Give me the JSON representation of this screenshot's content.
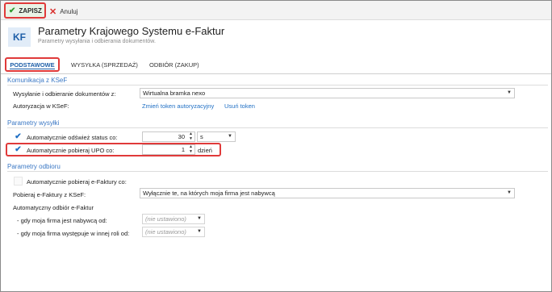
{
  "toolbar": {
    "save_label": "ZAPISZ",
    "cancel_label": "Anuluj"
  },
  "header": {
    "logo": "KF",
    "title": "Parametry Krajowego Systemu e-Faktur",
    "subtitle": "Parametry wysyłania i odbierania dokumentów."
  },
  "tabs": [
    {
      "label": "PODSTAWOWE",
      "active": true
    },
    {
      "label": "WYSYŁKA (SPRZEDAŻ)",
      "active": false
    },
    {
      "label": "ODBIÓR (ZAKUP)",
      "active": false
    }
  ],
  "komunikacja": {
    "title": "Komunikacja z KSeF",
    "send_receive_label": "Wysyłanie i odbieranie dokumentów z:",
    "send_receive_value": "Wirtualna bramka nexo",
    "auth_label": "Autoryzacja w KSeF:",
    "change_token_link": "Zmień token autoryzacyjny",
    "remove_token_link": "Usuń token"
  },
  "wysylka": {
    "title": "Parametry wysyłki",
    "refresh_label": "Automatycznie odśwież status co:",
    "refresh_value": "30",
    "refresh_unit": "s",
    "upo_label": "Automatycznie pobieraj UPO co:",
    "upo_value": "1",
    "upo_unit": "dzień",
    "refresh_checked": true,
    "upo_checked": true
  },
  "odbior": {
    "title": "Parametry odbioru",
    "auto_fetch_label": "Automatycznie pobieraj e-Faktury co:",
    "auto_fetch_checked": false,
    "fetch_label": "Pobieraj e-Faktury z KSeF:",
    "fetch_value": "Wyłącznie te, na których moja firma jest nabywcą",
    "auto_receive_label": "Automatyczny odbiór e-Faktur",
    "buyer_label": "- gdy moja firma jest nabywcą od:",
    "buyer_value": "(nie ustawiono)",
    "other_role_label": "- gdy moja firma występuje w innej roli od:",
    "other_role_value": "(nie ustawiono)"
  },
  "icons": {
    "save": "check-icon",
    "cancel": "x-icon",
    "dropdown": "chevron-down-icon",
    "spinner": "spinner-arrows-icon"
  },
  "colors": {
    "accent": "#1f5fa8",
    "section": "#3b78c4",
    "highlight": "#e03a3a",
    "save_check": "#2d9a2d",
    "cancel_x": "#d9302c"
  }
}
